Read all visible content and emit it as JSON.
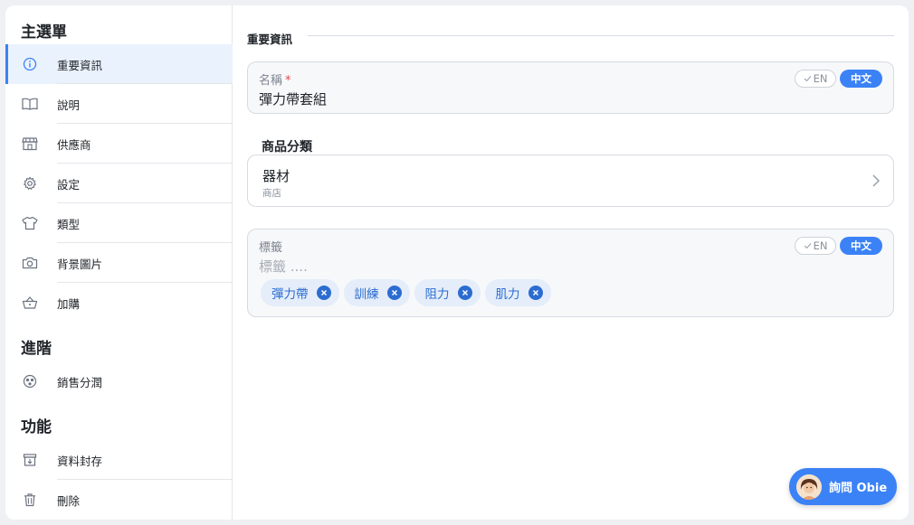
{
  "sidebar": {
    "sections": {
      "main": "主選單",
      "advanced": "進階",
      "functions": "功能"
    },
    "items": [
      {
        "label": "重要資訊",
        "icon": "info-icon",
        "active": true
      },
      {
        "label": "說明",
        "icon": "book-icon"
      },
      {
        "label": "供應商",
        "icon": "store-icon"
      },
      {
        "label": "設定",
        "icon": "gear-icon"
      },
      {
        "label": "類型",
        "icon": "shirt-icon"
      },
      {
        "label": "背景圖片",
        "icon": "camera-icon"
      },
      {
        "label": "加購",
        "icon": "basket-icon"
      },
      {
        "label": "銷售分潤",
        "icon": "pie-icon"
      },
      {
        "label": "資料封存",
        "icon": "archive-icon"
      },
      {
        "label": "刪除",
        "icon": "trash-icon"
      }
    ]
  },
  "main": {
    "heading": "重要資訊",
    "name_field": {
      "label": "名稱",
      "required_mark": "*",
      "value": "彈力帶套組",
      "lang_en": "EN",
      "lang_zh": "中文"
    },
    "category": {
      "heading": "商品分類",
      "value": "器材",
      "sub": "商店"
    },
    "tags_field": {
      "label": "標籤",
      "placeholder": "標籤 ....",
      "lang_en": "EN",
      "lang_zh": "中文",
      "tags": [
        "彈力帶",
        "訓練",
        "阻力",
        "肌力"
      ]
    },
    "assistant_button": "詢問 Obie"
  },
  "colors": {
    "accent": "#3b82f6",
    "active_bg": "#eaf2fd",
    "tag_bg": "#e4edf9",
    "tag_text": "#2b6cd1",
    "required": "#e5484d"
  }
}
